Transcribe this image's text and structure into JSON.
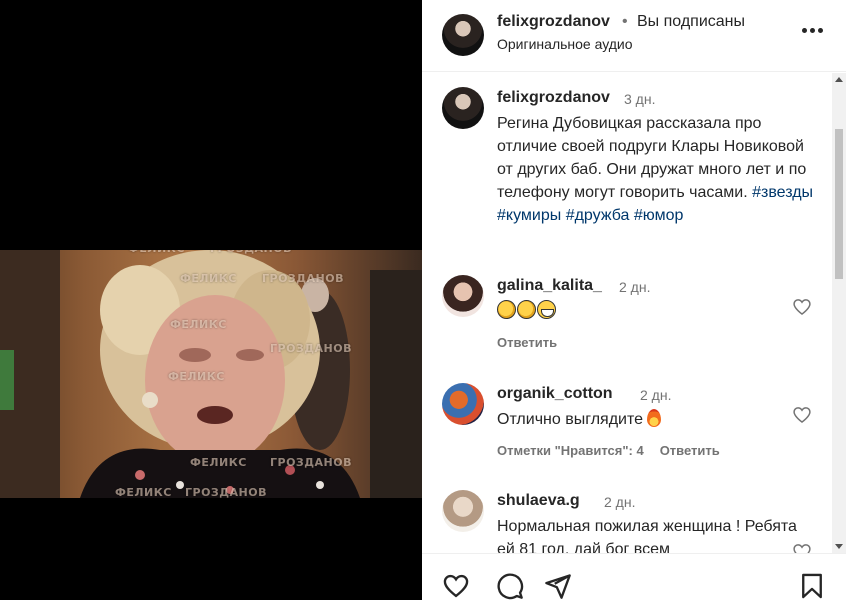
{
  "header": {
    "username": "felixgrozdanov",
    "separator": "•",
    "follow_status": "Вы подписаны",
    "audio": "Оригинальное аудио",
    "more_icon": "more-horizontal-icon"
  },
  "video": {
    "watermarks": [
      "ФЕЛИКС",
      "ГРОЗДАНОВ"
    ]
  },
  "caption": {
    "username": "felixgrozdanov",
    "time": "3 дн.",
    "text": "Регина Дубовицкая рассказала про отличие своей подруги Клары Новиковой от других баб. Они дружат много лет и по телефону могут говорить часами.",
    "hashtags": [
      "#звезды",
      "#кумиры",
      "#дружба",
      "#юмор"
    ]
  },
  "comments": [
    {
      "username": "galina_kalita_",
      "time": "2 дн.",
      "text": "",
      "emojis": [
        "clapping-hands",
        "clapping-hands",
        "grinning-face"
      ],
      "meta": [
        {
          "label": "Ответить"
        }
      ]
    },
    {
      "username": "organik_cotton",
      "time": "2 дн.",
      "text": "Отлично выглядите",
      "emojis": [
        "fire"
      ],
      "meta": [
        {
          "label": "Отметки \"Нравится\": 4"
        },
        {
          "label": "Ответить"
        }
      ]
    },
    {
      "username": "shulaeva.g",
      "time": "2 дн.",
      "text": "Нормальная пожилая женщина ! Ребята ей 81 год, дай бог всем",
      "emojis": [],
      "meta": []
    }
  ],
  "actions": {
    "like_icon": "heart-icon",
    "comment_icon": "comment-icon",
    "share_icon": "share-icon",
    "save_icon": "bookmark-icon"
  }
}
